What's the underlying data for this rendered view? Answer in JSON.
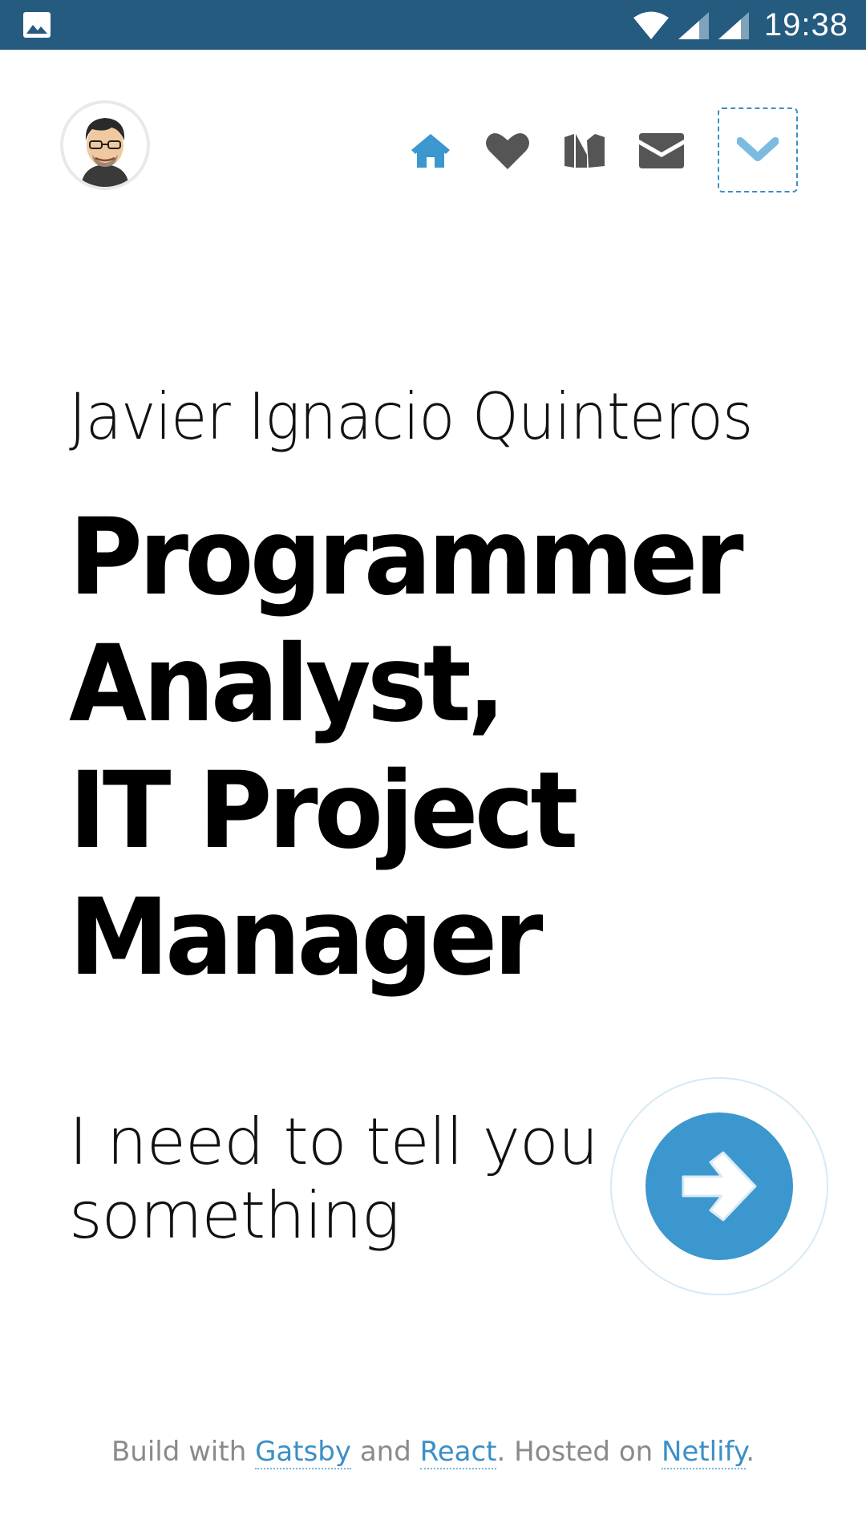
{
  "status_bar": {
    "time": "19:38",
    "icons": [
      "gallery-icon",
      "wifi-icon",
      "signal-icon",
      "signal-icon"
    ]
  },
  "nav": {
    "items": [
      "home-icon",
      "heart-icon",
      "medium-icon",
      "envelope-icon"
    ],
    "toggle_icon": "chevron-down-icon"
  },
  "hero": {
    "name": "Javier Ignacio Quinteros",
    "title_lines": [
      "Programmer",
      "Analyst,",
      "IT Project",
      "Manager"
    ]
  },
  "cta": {
    "text_lines": [
      "I need to tell you",
      "something"
    ],
    "icon": "arrow-right-icon"
  },
  "footer": {
    "prefix": "Build with ",
    "link1": "Gatsby",
    "mid1": " and ",
    "link2": "React",
    "mid2": ". Hosted on ",
    "link3": "Netlify",
    "suffix": "."
  },
  "colors": {
    "status_bar": "#245b7e",
    "accent": "#3b97cd",
    "icon_gray": "#555555",
    "text": "#111111"
  }
}
